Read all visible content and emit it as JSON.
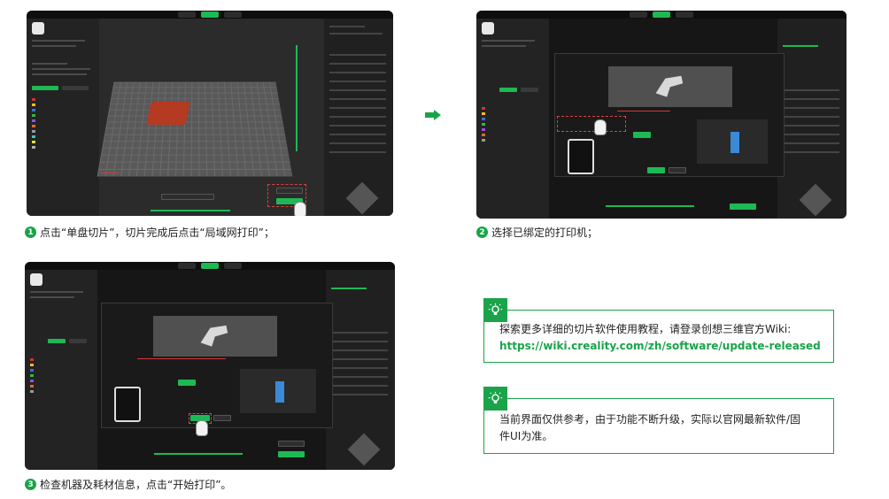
{
  "steps": [
    {
      "number": "1",
      "text": "点击“单盘切片”，切片完成后点击“局域网打印”；"
    },
    {
      "number": "2",
      "text": "选择已绑定的打印机；"
    },
    {
      "number": "3",
      "text": "检查机器及耗材信息，点击“开始打印”。"
    }
  ],
  "tips": [
    {
      "line1": "探索更多详细的切片软件使用教程，请登录创想三维官方Wiki:",
      "link": "https://wiki.creality.com/zh/software/update-released"
    },
    {
      "line1": "当前界面仅供参考，由于功能不断升级，实际以官网最新软件/固",
      "line2": "件UI为准。"
    }
  ],
  "icons": {
    "arrow": "arrow-right-icon",
    "tip": "lightbulb-icon",
    "cursor": "hand-pointer-icon"
  },
  "colors": {
    "accent": "#1aa34a",
    "ui_green": "#1db954",
    "dark_bg": "#161616"
  }
}
